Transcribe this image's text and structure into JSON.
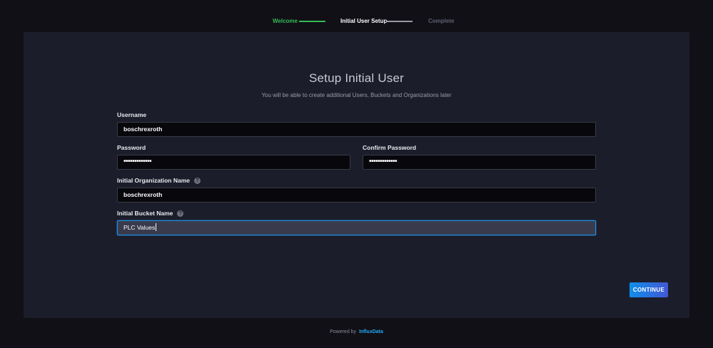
{
  "stepper": {
    "steps": [
      {
        "label": "Welcome",
        "state": "done"
      },
      {
        "label": "Initial User Setup",
        "state": "current"
      },
      {
        "label": "Complete",
        "state": "pending"
      }
    ]
  },
  "form": {
    "title": "Setup Initial User",
    "subtitle": "You will be able to create additional Users, Buckets and Organizations later",
    "username": {
      "label": "Username",
      "value": "boschrexroth"
    },
    "password": {
      "label": "Password",
      "value": "•••••••••••••"
    },
    "confirm_password": {
      "label": "Confirm Password",
      "value": "•••••••••••••"
    },
    "org_name": {
      "label": "Initial Organization Name",
      "value": "boschrexroth",
      "help_icon": "?"
    },
    "bucket_name": {
      "label": "Initial Bucket Name",
      "value": "PLC Values",
      "help_icon": "?"
    },
    "continue_label": "CONTINUE"
  },
  "footer": {
    "powered_by": "Powered by",
    "brand": "InfluxData"
  },
  "colors": {
    "background": "#101016",
    "panel": "#1c1d2a",
    "step_done": "#34bb55",
    "focus_border": "#1e8de0",
    "button_gradient_start": "#0f8fe8",
    "button_gradient_end": "#4257d6",
    "brand_link": "#23a8f2"
  }
}
